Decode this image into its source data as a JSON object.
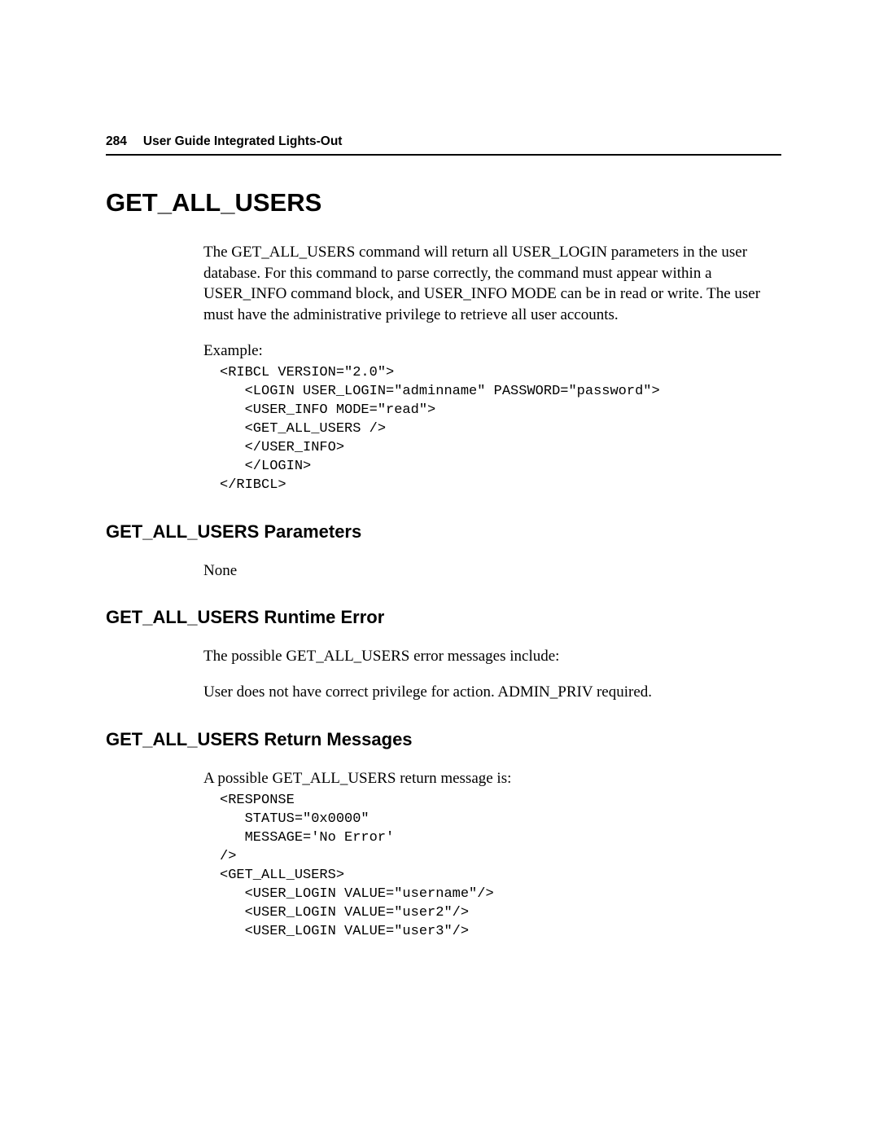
{
  "header": {
    "page_number": "284",
    "doc_title": "User Guide Integrated Lights-Out"
  },
  "section": {
    "title": "GET_ALL_USERS",
    "intro": "The GET_ALL_USERS command will return all USER_LOGIN parameters in the user database. For this command to parse correctly, the command must appear within a USER_INFO command block, and USER_INFO MODE can be in read or write. The user must have the administrative privilege to retrieve all user accounts.",
    "example_label": "Example:",
    "example_code": "<RIBCL VERSION=\"2.0\">\n   <LOGIN USER_LOGIN=\"adminname\" PASSWORD=\"password\">\n   <USER_INFO MODE=\"read\">\n   <GET_ALL_USERS />\n   </USER_INFO>\n   </LOGIN>\n</RIBCL>",
    "sub_params": {
      "title": "GET_ALL_USERS Parameters",
      "text": "None"
    },
    "sub_runtime": {
      "title": "GET_ALL_USERS Runtime Error",
      "text1": "The possible GET_ALL_USERS error messages include:",
      "text2": "User does not have correct privilege for action. ADMIN_PRIV required."
    },
    "sub_return": {
      "title": "GET_ALL_USERS Return Messages",
      "text": "A possible GET_ALL_USERS return message is:",
      "code": "<RESPONSE\n   STATUS=\"0x0000\"\n   MESSAGE='No Error'\n/>\n<GET_ALL_USERS>\n   <USER_LOGIN VALUE=\"username\"/>\n   <USER_LOGIN VALUE=\"user2\"/>\n   <USER_LOGIN VALUE=\"user3\"/>"
    }
  }
}
